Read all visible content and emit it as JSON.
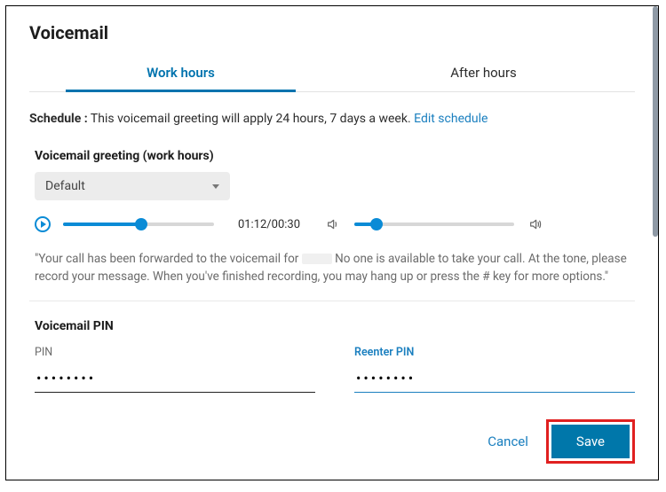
{
  "title": "Voicemail",
  "tabs": {
    "work_hours": "Work hours",
    "after_hours": "After hours"
  },
  "schedule": {
    "label": "Schedule :",
    "description": " This voicemail greeting will apply 24 hours, 7 days a week.  ",
    "edit_link": "Edit schedule"
  },
  "greeting": {
    "heading": "Voicemail greeting (work hours)",
    "select_value": "Default",
    "time_display": "01:12/00:30",
    "transcript_prefix": "\"Your call has been forwarded to the voicemail for",
    "transcript_suffix": " No one is available to take your call. At the tone, please record your message. When you've finished recording, you may hang up or press the # key for more options.\""
  },
  "pin": {
    "heading": "Voicemail PIN",
    "label_pin": "PIN",
    "label_reenter": "Reenter PIN",
    "value_pin": "••••••••",
    "value_reenter": "••••••••"
  },
  "footer": {
    "cancel": "Cancel",
    "save": "Save"
  }
}
